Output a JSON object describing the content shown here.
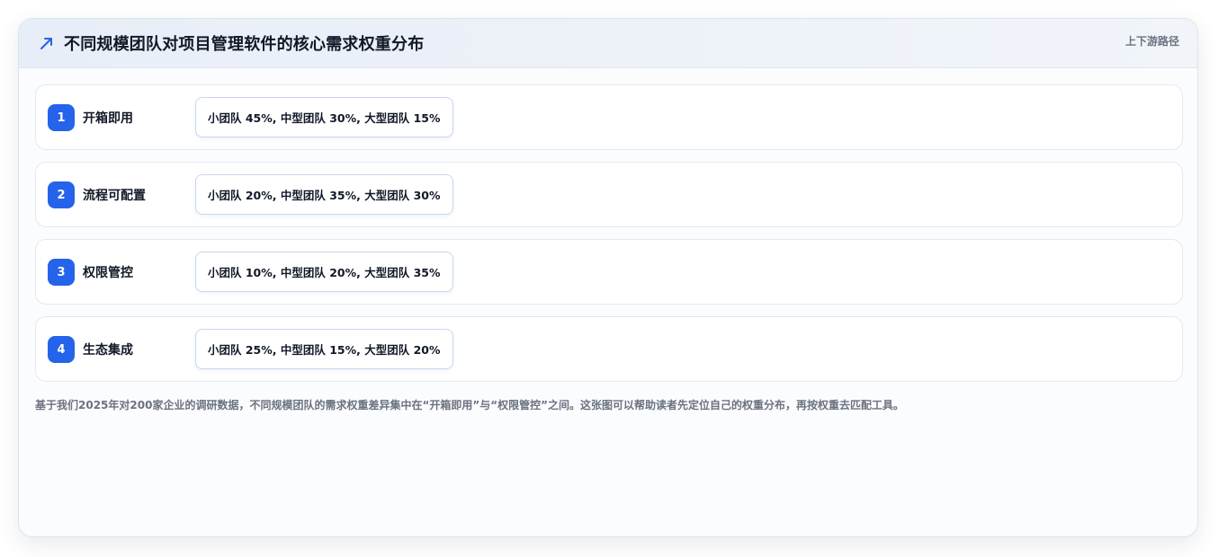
{
  "header": {
    "title": "不同规模团队对项目管理软件的核心需求权重分布",
    "tag": "上下游路径",
    "icon": "trend-up-arrow-icon",
    "accent_color": "#2563eb"
  },
  "rows": [
    {
      "number": "1",
      "label": "开箱即用",
      "summary": "小团队 45%, 中型团队 30%, 大型团队 15%"
    },
    {
      "number": "2",
      "label": "流程可配置",
      "summary": "小团队 20%, 中型团队 35%, 大型团队 30%"
    },
    {
      "number": "3",
      "label": "权限管控",
      "summary": "小团队 10%, 中型团队 20%, 大型团队 35%"
    },
    {
      "number": "4",
      "label": "生态集成",
      "summary": "小团队 25%, 中型团队 15%, 大型团队 20%"
    }
  ],
  "footnote": "基于我们2025年对200家企业的调研数据，不同规模团队的需求权重差异集中在“开箱即用”与“权限管控”之间。这张图可以帮助读者先定位自己的权重分布，再按权重去匹配工具。"
}
